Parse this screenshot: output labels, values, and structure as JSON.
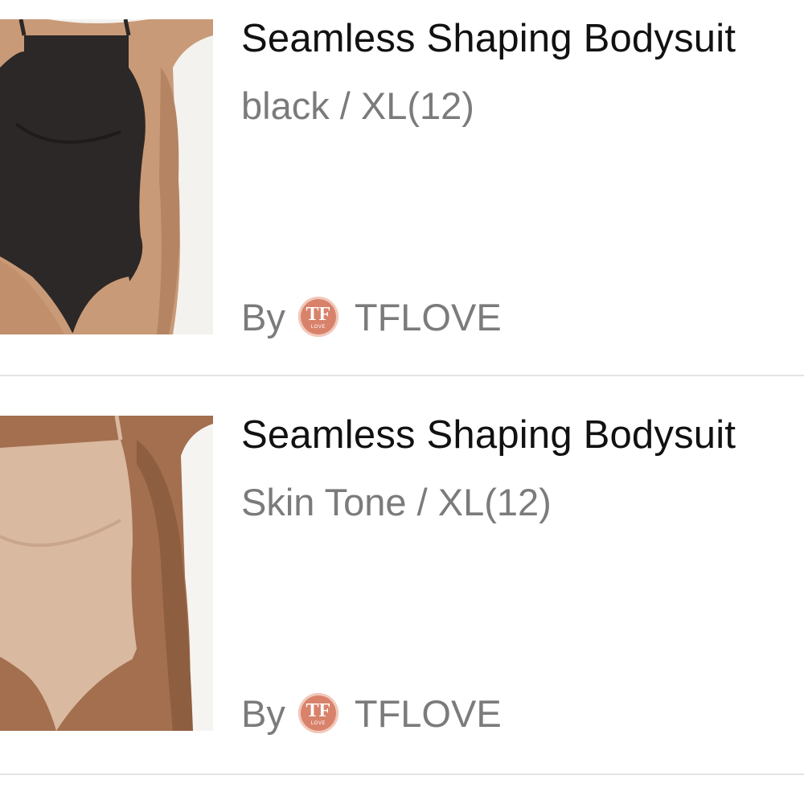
{
  "cart_items": [
    {
      "title": "Seamless Shaping Bodysuit",
      "variant": "black / XL(12)",
      "by_label": "By",
      "seller": "TFLOVE",
      "logo_text": "TF",
      "logo_subtext": "LOVE",
      "image_color": "#2b2827"
    },
    {
      "title": "Seamless Shaping Bodysuit",
      "variant": "Skin Tone / XL(12)",
      "by_label": "By",
      "seller": "TFLOVE",
      "logo_text": "TF",
      "logo_subtext": "LOVE",
      "image_color": "#d9b9a0"
    }
  ]
}
